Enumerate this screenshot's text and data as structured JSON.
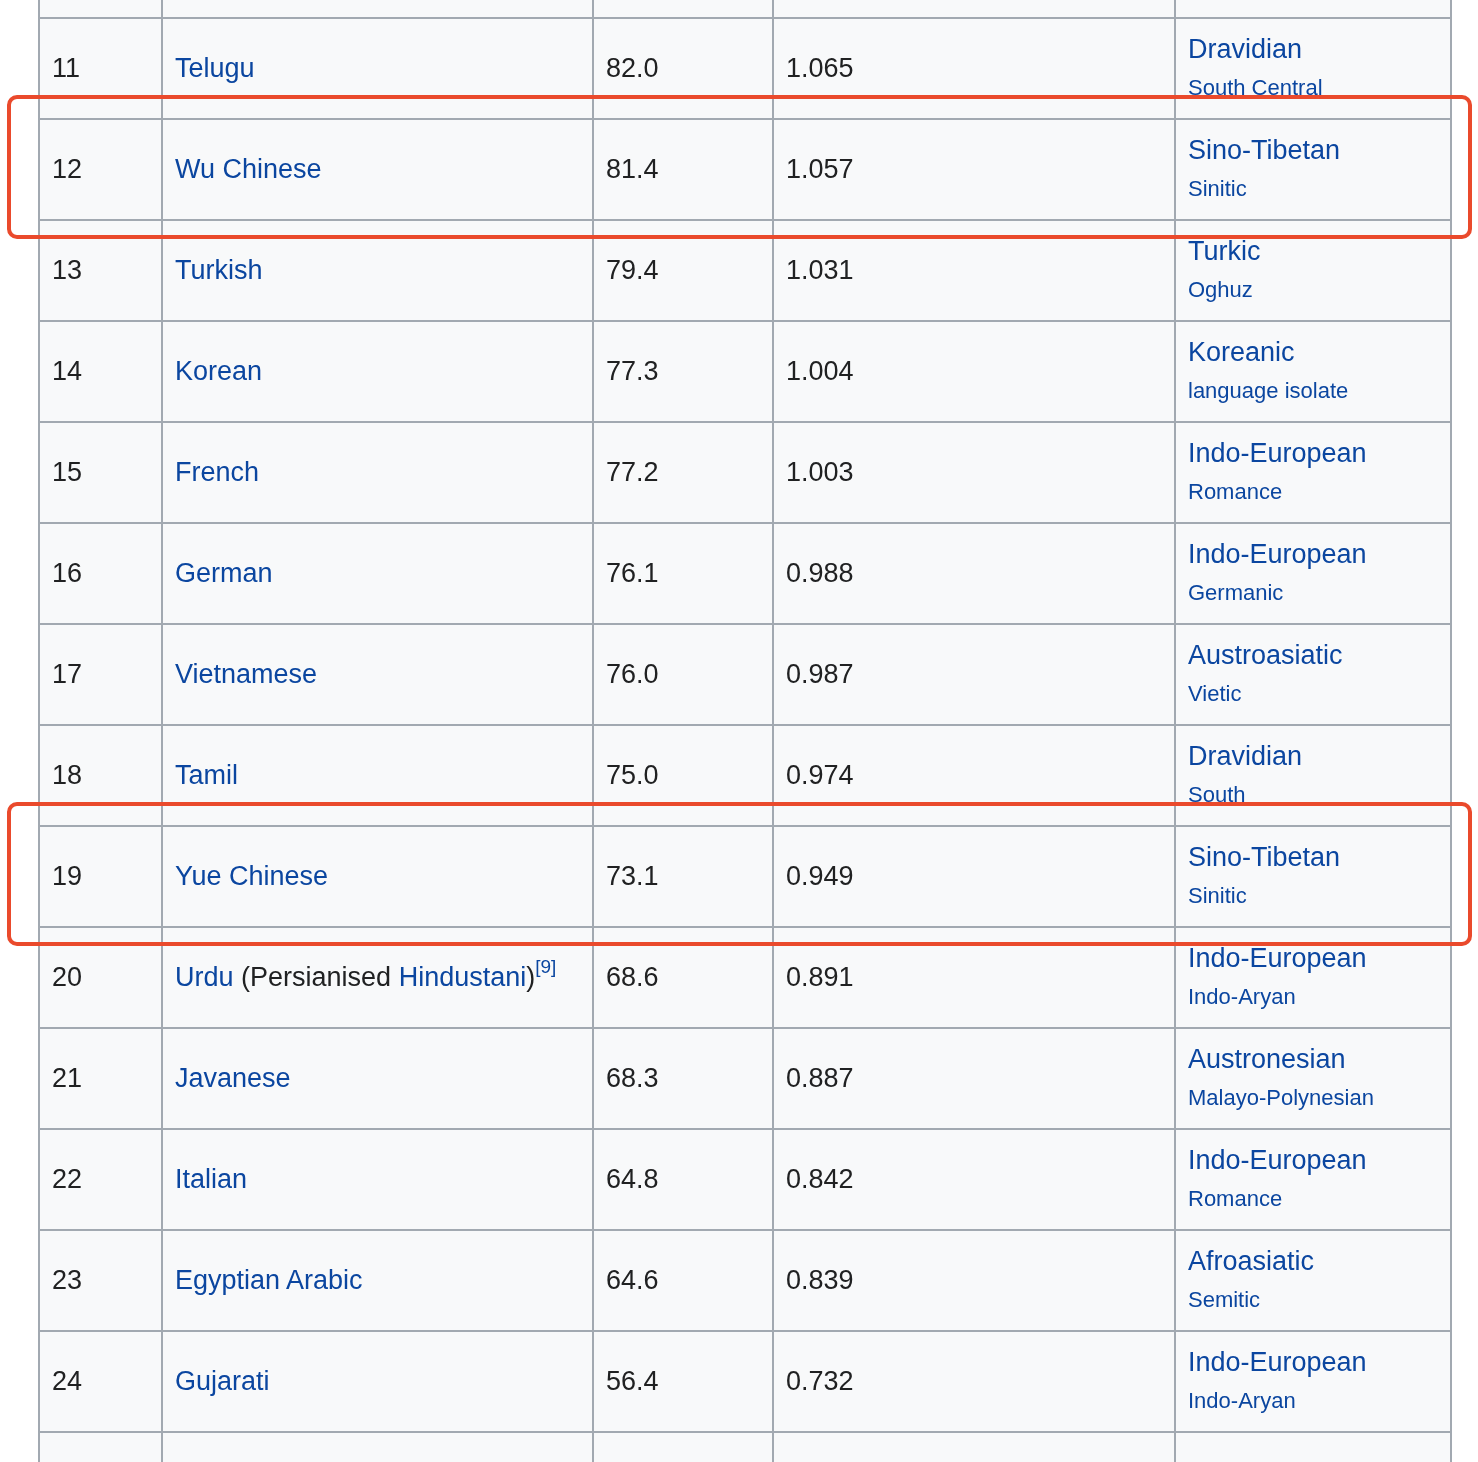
{
  "table": {
    "rows": [
      {
        "kind": "partial"
      },
      {
        "kind": "row",
        "rank": "11",
        "language": [
          {
            "text": "Telugu",
            "kind": "link"
          }
        ],
        "column_3": "82.0",
        "column_4": "1.065",
        "family": "Dravidian",
        "branch": "South Central",
        "highlighted": false
      },
      {
        "kind": "row",
        "rank": "12",
        "language": [
          {
            "text": "Wu Chinese",
            "kind": "link"
          }
        ],
        "column_3": "81.4",
        "column_4": "1.057",
        "family": "Sino-Tibetan",
        "branch": "Sinitic",
        "highlighted": true
      },
      {
        "kind": "row",
        "rank": "13",
        "language": [
          {
            "text": "Turkish",
            "kind": "link"
          }
        ],
        "column_3": "79.4",
        "column_4": "1.031",
        "family": "Turkic",
        "branch": "Oghuz",
        "highlighted": false
      },
      {
        "kind": "row",
        "rank": "14",
        "language": [
          {
            "text": "Korean",
            "kind": "link"
          }
        ],
        "column_3": "77.3",
        "column_4": "1.004",
        "family": "Koreanic",
        "branch": "language isolate",
        "highlighted": false
      },
      {
        "kind": "row",
        "rank": "15",
        "language": [
          {
            "text": "French",
            "kind": "link"
          }
        ],
        "column_3": "77.2",
        "column_4": "1.003",
        "family": "Indo-European",
        "branch": "Romance",
        "highlighted": false
      },
      {
        "kind": "row",
        "rank": "16",
        "language": [
          {
            "text": "German",
            "kind": "link"
          }
        ],
        "column_3": "76.1",
        "column_4": "0.988",
        "family": "Indo-European",
        "branch": "Germanic",
        "highlighted": false
      },
      {
        "kind": "row",
        "rank": "17",
        "language": [
          {
            "text": "Vietnamese",
            "kind": "link"
          }
        ],
        "column_3": "76.0",
        "column_4": "0.987",
        "family": "Austroasiatic",
        "branch": "Vietic",
        "highlighted": false
      },
      {
        "kind": "row",
        "rank": "18",
        "language": [
          {
            "text": "Tamil",
            "kind": "link"
          }
        ],
        "column_3": "75.0",
        "column_4": "0.974",
        "family": "Dravidian",
        "branch": "South",
        "highlighted": false
      },
      {
        "kind": "row",
        "rank": "19",
        "language": [
          {
            "text": "Yue Chinese",
            "kind": "link"
          }
        ],
        "column_3": "73.1",
        "column_4": "0.949",
        "family": "Sino-Tibetan",
        "branch": "Sinitic",
        "highlighted": true
      },
      {
        "kind": "row",
        "rank": "20",
        "language": [
          {
            "text": "Urdu",
            "kind": "link"
          },
          {
            "text": "(Persianised",
            "kind": "text"
          },
          {
            "text": "Hindustani",
            "kind": "link"
          },
          {
            "text": ")",
            "kind": "text"
          },
          {
            "text": "[9]",
            "kind": "footnote"
          }
        ],
        "column_3": "68.6",
        "column_4": "0.891",
        "family": "Indo-European",
        "branch": "Indo-Aryan",
        "highlighted": false
      },
      {
        "kind": "row",
        "rank": "21",
        "language": [
          {
            "text": "Javanese",
            "kind": "link"
          }
        ],
        "column_3": "68.3",
        "column_4": "0.887",
        "family": "Austronesian",
        "branch": "Malayo-Polynesian",
        "highlighted": false
      },
      {
        "kind": "row",
        "rank": "22",
        "language": [
          {
            "text": "Italian",
            "kind": "link"
          }
        ],
        "column_3": "64.8",
        "column_4": "0.842",
        "family": "Indo-European",
        "branch": "Romance",
        "highlighted": false
      },
      {
        "kind": "row",
        "rank": "23",
        "language": [
          {
            "text": "Egyptian Arabic",
            "kind": "link"
          }
        ],
        "column_3": "64.6",
        "column_4": "0.839",
        "family": "Afroasiatic",
        "branch": "Semitic",
        "highlighted": false
      },
      {
        "kind": "row",
        "rank": "24",
        "language": [
          {
            "text": "Gujarati",
            "kind": "link"
          }
        ],
        "column_3": "56.4",
        "column_4": "0.732",
        "family": "Indo-European",
        "branch": "Indo-Aryan",
        "highlighted": false
      },
      {
        "kind": "partial"
      }
    ]
  }
}
